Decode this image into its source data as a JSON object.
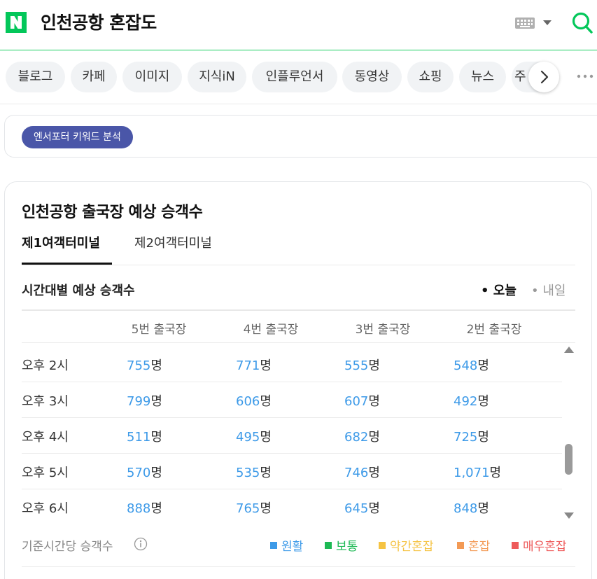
{
  "header": {
    "logo_letter": "N",
    "query": "인천공항 혼잡도",
    "brand_color": "#03c75a"
  },
  "tabs": {
    "items": [
      {
        "label": "블로그"
      },
      {
        "label": "카페"
      },
      {
        "label": "이미지"
      },
      {
        "label": "지식iN"
      },
      {
        "label": "인플루언서"
      },
      {
        "label": "동영상"
      },
      {
        "label": "쇼핑"
      },
      {
        "label": "뉴스"
      },
      {
        "label": "주"
      }
    ]
  },
  "keyword_badge": "엔서포터 키워드 분석",
  "card": {
    "title": "인천공항 출국장 예상 승객수",
    "terminals": [
      "제1여객터미널",
      "제2여객터미널"
    ],
    "sub_title": "시간대별 예상 승객수",
    "day_today": "• 오늘",
    "day_tomorrow": "• 내일",
    "columns": [
      "5번 출국장",
      "4번 출국장",
      "3번 출국장",
      "2번 출국장"
    ],
    "unit": "명",
    "rows": [
      {
        "time": "오후 2시",
        "values": [
          "755",
          "771",
          "555",
          "548"
        ]
      },
      {
        "time": "오후 3시",
        "values": [
          "799",
          "606",
          "607",
          "492"
        ]
      },
      {
        "time": "오후 4시",
        "values": [
          "511",
          "495",
          "682",
          "725"
        ]
      },
      {
        "time": "오후 5시",
        "values": [
          "570",
          "535",
          "746",
          "1,071"
        ]
      },
      {
        "time": "오후 6시",
        "values": [
          "888",
          "765",
          "645",
          "848"
        ]
      }
    ],
    "basis": "기준시간당 승객수",
    "legend": [
      {
        "label": "원활",
        "color": "#3d9ae8"
      },
      {
        "label": "보통",
        "color": "#1db954"
      },
      {
        "label": "약간혼잡",
        "color": "#f5c343"
      },
      {
        "label": "혼잡",
        "color": "#f39a55"
      },
      {
        "label": "매우혼잡",
        "color": "#ee5a5a"
      }
    ],
    "number_color": "#3d9ae8"
  }
}
